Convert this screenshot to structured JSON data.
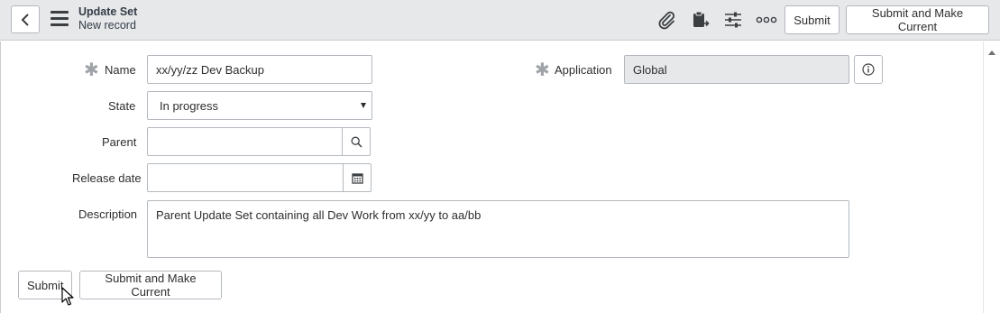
{
  "header": {
    "title": "Update Set",
    "subtitle": "New record",
    "icons": [
      "back-icon",
      "menu-icon",
      "paperclip-icon",
      "clipboard-icon",
      "sliders-icon",
      "more-icon"
    ],
    "submit_label": "Submit",
    "submit_current_label": "Submit and Make Current"
  },
  "form": {
    "name": {
      "label": "Name",
      "value": "xx/yy/zz Dev Backup",
      "required": true
    },
    "application": {
      "label": "Application",
      "value": "Global",
      "required": true
    },
    "state": {
      "label": "State",
      "value": "In progress",
      "options": [
        "In progress"
      ]
    },
    "parent": {
      "label": "Parent",
      "value": ""
    },
    "release_date": {
      "label": "Release date",
      "value": ""
    },
    "description": {
      "label": "Description",
      "value": "Parent Update Set containing all Dev Work from xx/yy to aa/bb"
    }
  },
  "footer": {
    "submit_label": "Submit",
    "submit_current_label": "Submit and Make Current"
  },
  "colors": {
    "header_bg": "#e6e8ea",
    "border": "#b3b9bf",
    "readonly_bg": "#e6e8ea",
    "text": "#2e2e2e"
  }
}
